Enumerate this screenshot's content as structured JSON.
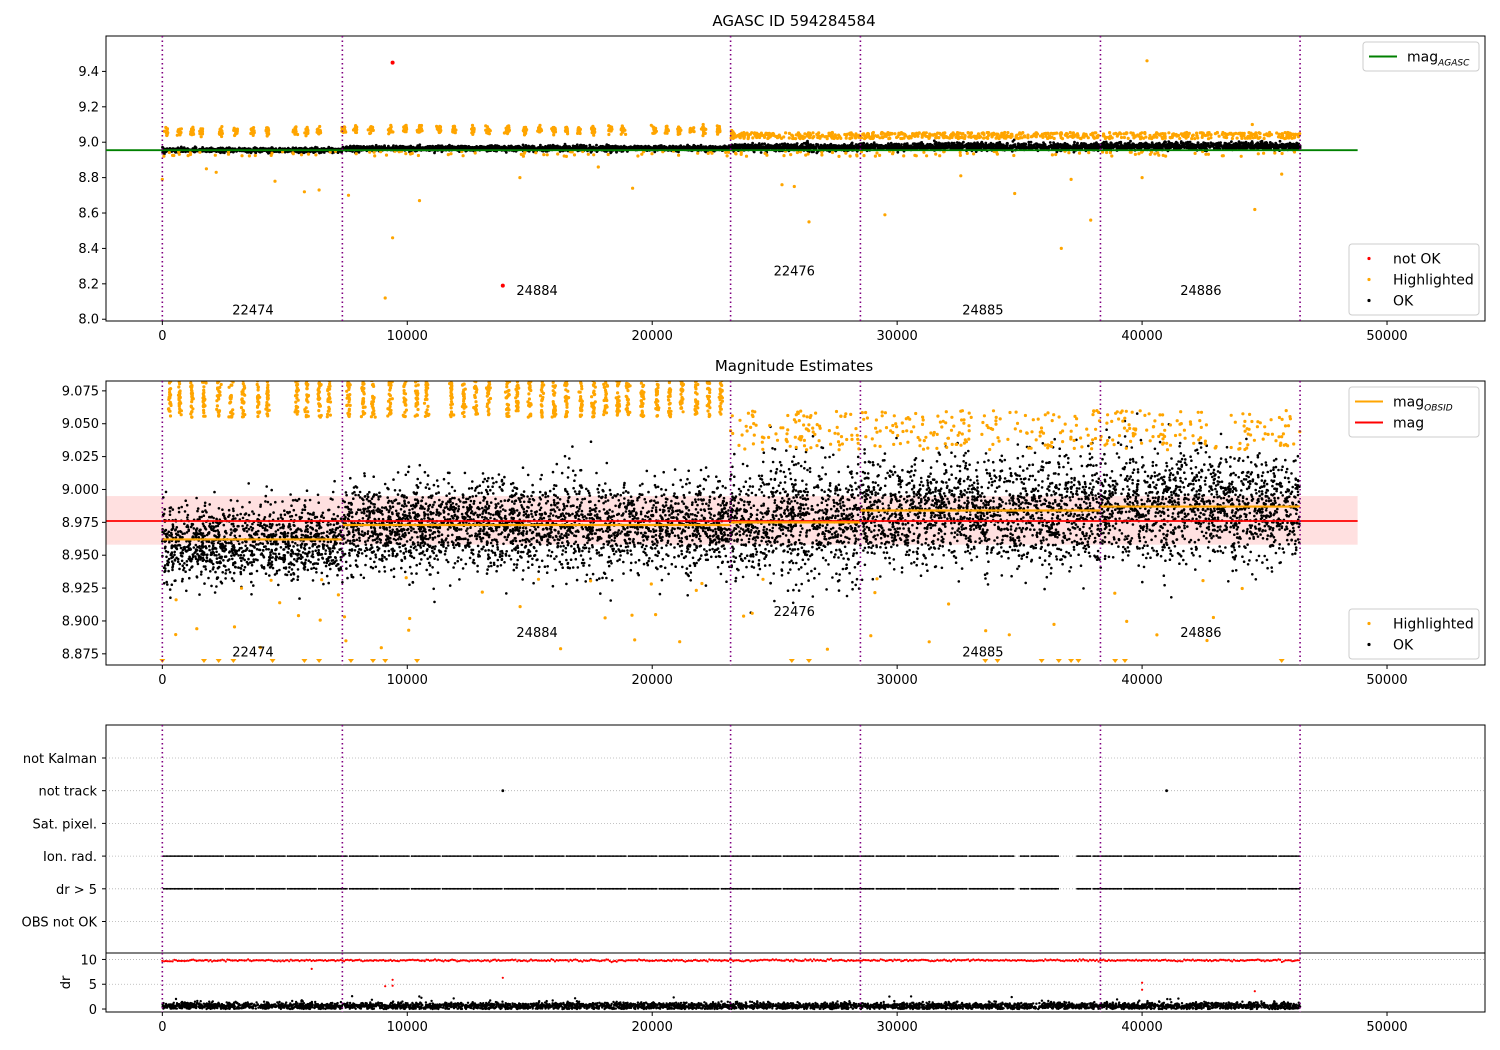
{
  "chart_data": [
    {
      "type": "scatter",
      "title": "AGASC ID 594284584",
      "xlim": [
        -2300,
        54000
      ],
      "ylim": [
        7.99,
        9.6
      ],
      "xticks": [
        0,
        10000,
        20000,
        30000,
        40000,
        50000
      ],
      "yticks": [
        8.0,
        8.2,
        8.4,
        8.6,
        8.8,
        9.0,
        9.2,
        9.4
      ],
      "grid": false,
      "legend_top": {
        "placement": "top-right",
        "entries": [
          {
            "label": "mag",
            "sub": "AGASC",
            "color": "#008000",
            "kind": "line"
          }
        ]
      },
      "legend_bottom": {
        "placement": "bottom-right",
        "entries": [
          {
            "label": "not OK",
            "color": "#ff0000",
            "kind": "dot"
          },
          {
            "label": "Highlighted",
            "color": "#ffa500",
            "kind": "dot"
          },
          {
            "label": "OK",
            "color": "#000000",
            "kind": "dot"
          }
        ]
      },
      "boundaries": [
        0,
        7350,
        23200,
        28500,
        38300,
        46450
      ],
      "obsids": [
        {
          "label": "22474",
          "x": 3700,
          "y": 8.05
        },
        {
          "label": "24884",
          "x": 15300,
          "y": 8.16
        },
        {
          "label": "22476",
          "x": 25800,
          "y": 8.27
        },
        {
          "label": "24885",
          "x": 33500,
          "y": 8.05
        },
        {
          "label": "24886",
          "x": 42400,
          "y": 8.16
        }
      ],
      "mag_agasc": {
        "value": 8.955,
        "x": [
          -2300,
          48800
        ],
        "color": "#008000"
      },
      "segments": [
        {
          "x0": 0,
          "x1": 7350,
          "center": 8.955,
          "spread": 0.012
        },
        {
          "x0": 7350,
          "x1": 23200,
          "center": 8.965,
          "spread": 0.015
        },
        {
          "x0": 23200,
          "x1": 28500,
          "center": 8.97,
          "spread": 0.02
        },
        {
          "x0": 28500,
          "x1": 38300,
          "center": 8.975,
          "spread": 0.02
        },
        {
          "x0": 38300,
          "x1": 46450,
          "center": 8.978,
          "spread": 0.02
        }
      ],
      "not_ok_points": [
        {
          "x": 9400,
          "y": 9.45
        },
        {
          "x": 13900,
          "y": 8.19
        }
      ],
      "highlight_outliers": [
        {
          "x": 0,
          "y": 8.79
        },
        {
          "x": 1800,
          "y": 8.85
        },
        {
          "x": 2200,
          "y": 8.83
        },
        {
          "x": 4600,
          "y": 8.78
        },
        {
          "x": 5800,
          "y": 8.72
        },
        {
          "x": 6400,
          "y": 8.73
        },
        {
          "x": 7600,
          "y": 8.7
        },
        {
          "x": 9100,
          "y": 8.12
        },
        {
          "x": 9400,
          "y": 8.46
        },
        {
          "x": 10500,
          "y": 8.67
        },
        {
          "x": 14600,
          "y": 8.8
        },
        {
          "x": 17800,
          "y": 8.86
        },
        {
          "x": 19200,
          "y": 8.74
        },
        {
          "x": 25300,
          "y": 8.76
        },
        {
          "x": 25800,
          "y": 8.75
        },
        {
          "x": 26400,
          "y": 8.55
        },
        {
          "x": 29500,
          "y": 8.59
        },
        {
          "x": 32600,
          "y": 8.81
        },
        {
          "x": 34800,
          "y": 8.71
        },
        {
          "x": 36700,
          "y": 8.4
        },
        {
          "x": 37100,
          "y": 8.79
        },
        {
          "x": 37900,
          "y": 8.56
        },
        {
          "x": 40200,
          "y": 9.46
        },
        {
          "x": 40000,
          "y": 8.8
        },
        {
          "x": 44600,
          "y": 8.62
        },
        {
          "x": 45700,
          "y": 8.82
        },
        {
          "x": 44500,
          "y": 9.1
        }
      ],
      "highlight_bursts": [
        200,
        700,
        1200,
        1600,
        2400,
        3000,
        3700,
        4300,
        5400,
        5900,
        6400,
        7400,
        7900,
        8500,
        9300,
        9900,
        10500,
        11300,
        11900,
        12700,
        13300,
        14100,
        14800,
        15400,
        16000,
        16500,
        17000,
        17600,
        18300,
        18800,
        20100,
        20600,
        21100,
        21600,
        22100,
        22700,
        23300
      ]
    },
    {
      "type": "scatter",
      "title": "Magnitude Estimates",
      "xlim": [
        -2300,
        54000
      ],
      "ylim": [
        8.8665,
        9.0825
      ],
      "xticks": [
        0,
        10000,
        20000,
        30000,
        40000,
        50000
      ],
      "yticks": [
        8.875,
        8.9,
        8.925,
        8.95,
        8.975,
        9.0,
        9.025,
        9.05,
        9.075
      ],
      "ytick_labels": [
        "8.875",
        "8.900",
        "8.925",
        "8.950",
        "8.975",
        "9.000",
        "9.025",
        "9.050",
        "9.075"
      ],
      "grid": false,
      "legend_top": {
        "placement": "top-right",
        "entries": [
          {
            "label": "mag",
            "sub": "OBSID",
            "color": "#ffa500",
            "kind": "line"
          },
          {
            "label": "mag",
            "sub": "",
            "color": "#ff0000",
            "kind": "line"
          }
        ]
      },
      "legend_bottom": {
        "placement": "bottom-right",
        "entries": [
          {
            "label": "Highlighted",
            "color": "#ffa500",
            "kind": "dot"
          },
          {
            "label": "OK",
            "color": "#000000",
            "kind": "dot"
          }
        ]
      },
      "boundaries": [
        0,
        7350,
        23200,
        28500,
        38300,
        46450
      ],
      "obsids": [
        {
          "label": "22474",
          "x": 3700,
          "y": 8.876
        },
        {
          "label": "24884",
          "x": 15300,
          "y": 8.891
        },
        {
          "label": "22476",
          "x": 25800,
          "y": 8.907
        },
        {
          "label": "24885",
          "x": 33500,
          "y": 8.876
        },
        {
          "label": "24886",
          "x": 42400,
          "y": 8.891
        }
      ],
      "mag": {
        "value": 8.976,
        "band": [
          8.958,
          8.995
        ],
        "x": [
          -2300,
          48800
        ]
      },
      "mag_obsid": [
        {
          "x0": 0,
          "x1": 7350,
          "value": 8.962
        },
        {
          "x0": 7350,
          "x1": 23200,
          "value": 8.973
        },
        {
          "x0": 23200,
          "x1": 28500,
          "value": 8.975
        },
        {
          "x0": 28500,
          "x1": 38300,
          "value": 8.984
        },
        {
          "x0": 38300,
          "x1": 46450,
          "value": 8.987
        }
      ],
      "segments": [
        {
          "x0": 0,
          "x1": 7350,
          "center": 8.96,
          "spread": 0.014
        },
        {
          "x0": 7350,
          "x1": 23200,
          "center": 8.972,
          "spread": 0.017
        },
        {
          "x0": 23200,
          "x1": 28500,
          "center": 8.975,
          "spread": 0.022
        },
        {
          "x0": 28500,
          "x1": 38300,
          "center": 8.983,
          "spread": 0.02
        },
        {
          "x0": 38300,
          "x1": 46450,
          "center": 8.986,
          "spread": 0.02
        }
      ],
      "highlight_bursts": [
        300,
        700,
        1200,
        1700,
        2300,
        2800,
        3300,
        3900,
        4300,
        5500,
        5900,
        6400,
        6800,
        7600,
        8200,
        8600,
        9300,
        9900,
        10400,
        10800,
        11800,
        12300,
        12800,
        13300,
        14100,
        14500,
        15000,
        15500,
        16000,
        16500,
        17100,
        17600,
        18100,
        18600,
        19000,
        19600,
        20200,
        20700,
        21200,
        21800,
        22300,
        22800
      ]
    },
    {
      "type": "scatter",
      "title": "",
      "xlim": [
        -2300,
        54000
      ],
      "categories": [
        "not Kalman",
        "not track",
        "Sat. pixel.",
        "Ion. rad.",
        "dr > 5",
        "OBS not OK"
      ],
      "grid": "y-dotted",
      "boundaries": [
        0,
        7350,
        23200,
        28500,
        38300,
        46450
      ],
      "not_track_points": [
        13900,
        41000
      ],
      "flag_gaps": [
        [
          34800,
          35000
        ],
        [
          36600,
          37300
        ],
        [
          47000,
          54000
        ]
      ]
    },
    {
      "type": "scatter",
      "title": "",
      "xlim": [
        -2300,
        54000
      ],
      "ylim": [
        -0.6,
        11.3
      ],
      "ylabel": "dr",
      "xticks": [
        0,
        10000,
        20000,
        30000,
        40000,
        50000
      ],
      "yticks": [
        0,
        5,
        10
      ],
      "grid": "y-dotted",
      "boundaries": [
        0,
        7350,
        23200,
        28500,
        38300,
        46450
      ],
      "dr_ok_mean": 0.6,
      "dr_flagged": 9.8,
      "dr_scatter": [
        {
          "x": 6100,
          "y": 8.1
        },
        {
          "x": 9100,
          "y": 4.6
        },
        {
          "x": 9400,
          "y": 5.9
        },
        {
          "x": 9400,
          "y": 4.7
        },
        {
          "x": 13900,
          "y": 6.3
        },
        {
          "x": 40000,
          "y": 5.3
        },
        {
          "x": 40000,
          "y": 3.9
        },
        {
          "x": 44600,
          "y": 3.6
        }
      ]
    }
  ]
}
